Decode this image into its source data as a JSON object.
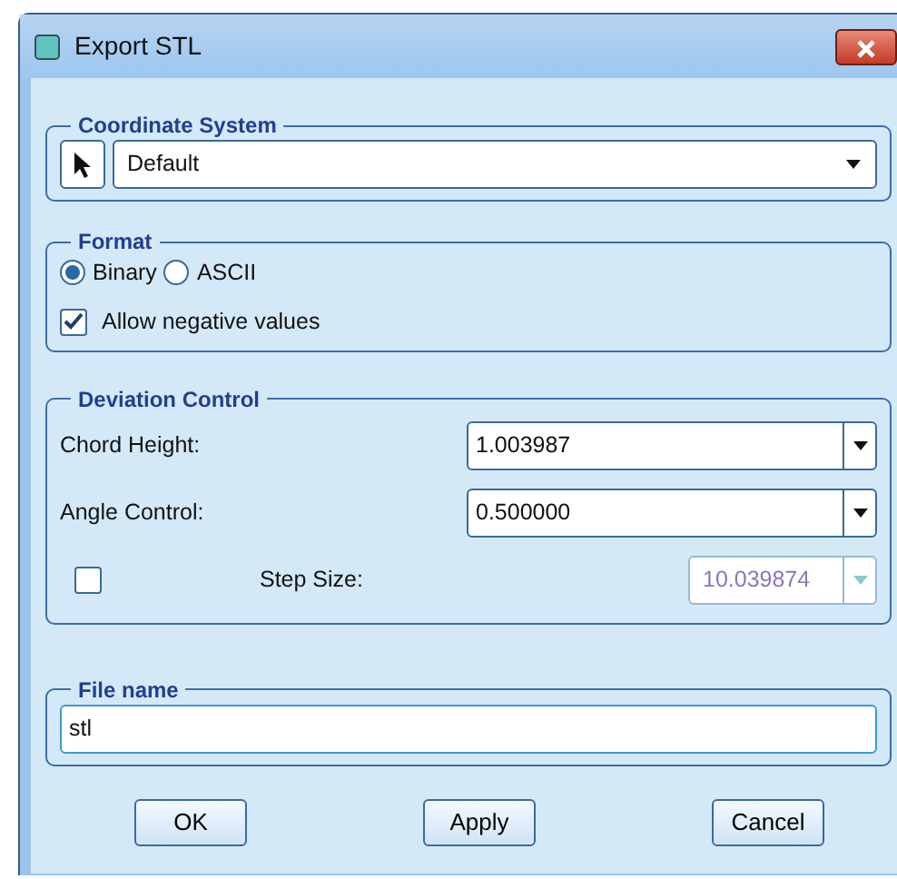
{
  "window": {
    "title": "Export STL"
  },
  "coordinate_system": {
    "legend": "Coordinate System",
    "value": "Default"
  },
  "format": {
    "legend": "Format",
    "options": [
      {
        "label": "Binary",
        "selected": true
      },
      {
        "label": "ASCII",
        "selected": false
      }
    ],
    "allow_negative": {
      "label": "Allow negative values",
      "checked": true
    }
  },
  "deviation_control": {
    "legend": "Deviation Control",
    "rows": [
      {
        "kind": "combo",
        "label": "Chord Height:",
        "value": "1.003987",
        "disabled": false
      },
      {
        "kind": "combo",
        "label": "Angle Control:",
        "value": "0.500000",
        "disabled": false
      },
      {
        "kind": "optional",
        "label": "Step Size:",
        "value": "10.039874",
        "disabled": true,
        "checked": false
      }
    ]
  },
  "file_name": {
    "legend": "File name",
    "value": "stl"
  },
  "buttons": [
    "OK",
    "Apply",
    "Cancel"
  ]
}
